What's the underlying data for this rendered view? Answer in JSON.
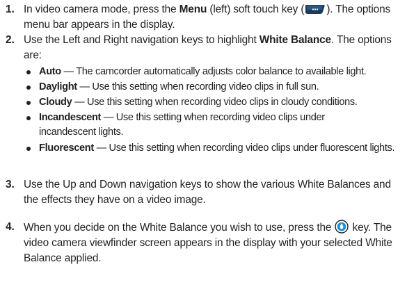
{
  "steps": [
    {
      "num": "1.",
      "pre": "In video camera mode, press the ",
      "b1": "Menu",
      "mid": " (left) soft touch key (",
      "post": "). The options menu bar appears in the display.",
      "icon": "menu-soft-key-icon"
    },
    {
      "num": "2.",
      "pre": "Use the Left and Right navigation keys to highlight ",
      "b1": "White Balance",
      "post": ". The options are:"
    },
    {
      "num": "3.",
      "text": "Use the Up and Down navigation keys to show the various White Balances and the effects they have on a video image."
    },
    {
      "num": "4.",
      "pre": "When you decide on the White Balance you wish to use, press the ",
      "post": " key. The video camera viewfinder screen appears in the display with your selected White Balance applied.",
      "icon": "ok-key-icon"
    }
  ],
  "options": [
    {
      "name": "Auto",
      "desc": " — The camcorder automatically adjusts color balance to available light."
    },
    {
      "name": "Daylight",
      "desc": " — Use this setting when recording video clips in full sun."
    },
    {
      "name": "Cloudy",
      "desc": " — Use this setting when recording video clips in cloudy conditions."
    },
    {
      "name": "Incandescent",
      "desc": " — Use this setting when recording video clips under incandescent lights."
    },
    {
      "name": "Fluorescent",
      "desc": " — Use this setting when recording video clips under fluorescent lights."
    }
  ],
  "colors": {
    "text": "#231f20",
    "key_blue": "#1e90d8",
    "key_dark": "#1b3a5c"
  }
}
